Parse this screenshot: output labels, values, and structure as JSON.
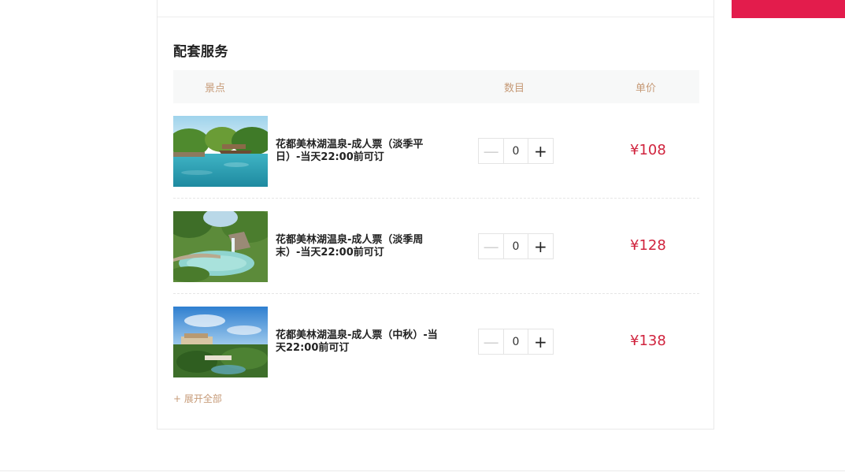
{
  "colors": {
    "accent": "#e31c4c",
    "price": "#d0233d",
    "header_text": "#c69a77",
    "header_bg": "#f7f8f8"
  },
  "section": {
    "title": "配套服务"
  },
  "table": {
    "headers": {
      "spot": "景点",
      "quantity": "数目",
      "unit_price": "单价"
    },
    "rows": [
      {
        "name": "花都美林湖温泉-成人票（淡季平日）-当天22:00前可订",
        "quantity": "0",
        "price": "¥108",
        "minus_icon": "minus-icon",
        "plus_icon": "plus-icon"
      },
      {
        "name": "花都美林湖温泉-成人票（淡季周末）-当天22:00前可订",
        "quantity": "0",
        "price": "¥128",
        "minus_icon": "minus-icon",
        "plus_icon": "plus-icon"
      },
      {
        "name": "花都美林湖温泉-成人票（中秋）-当天22:00前可订",
        "quantity": "0",
        "price": "¥138",
        "minus_icon": "minus-icon",
        "plus_icon": "plus-icon"
      }
    ]
  },
  "expand": {
    "label": "+ 展开全部"
  },
  "symbols": {
    "minus": "—",
    "plus": "+"
  }
}
